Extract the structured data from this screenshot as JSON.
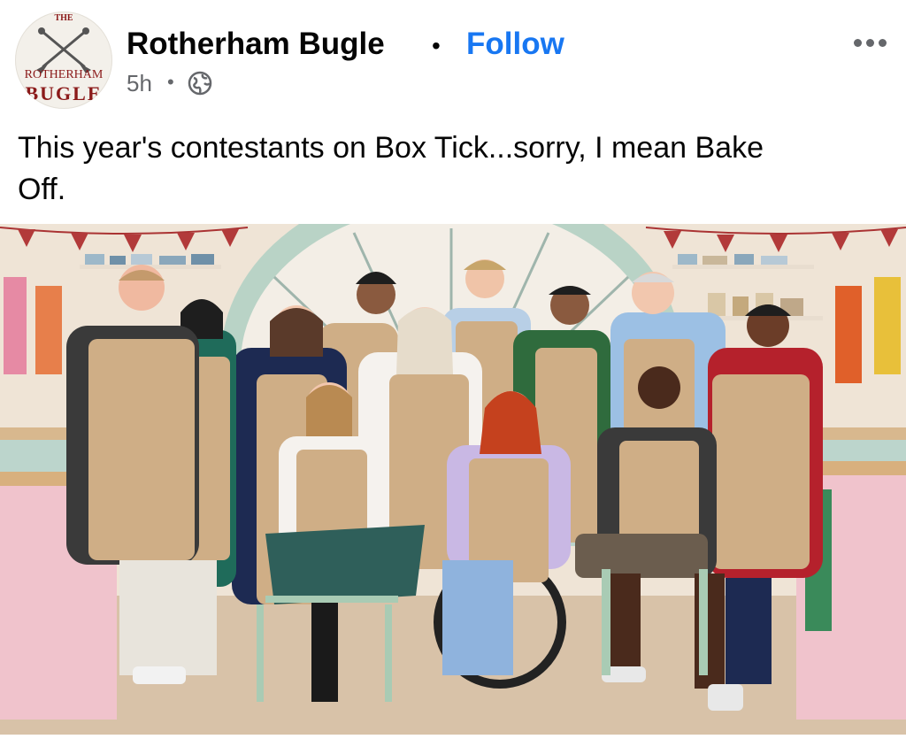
{
  "post": {
    "page_name": "Rotherham Bugle",
    "follow_label": "Follow",
    "separator": "•",
    "time": "5h",
    "time_separator": "•",
    "privacy_icon": "globe-icon",
    "more_icon": "more-options-icon",
    "caption": "This year's contestants on Box Tick...sorry, I mean Bake Off."
  },
  "avatar": {
    "logo_top": "THE",
    "logo_mid": "ROTHERHAM",
    "logo_bottom": "BUGLE"
  },
  "photo": {
    "subject": "contestants-group-photo"
  },
  "colors": {
    "follow": "#1877f2",
    "meta": "#65676b",
    "apron": "#cfae86",
    "counter_pink": "#f0c3cc"
  }
}
